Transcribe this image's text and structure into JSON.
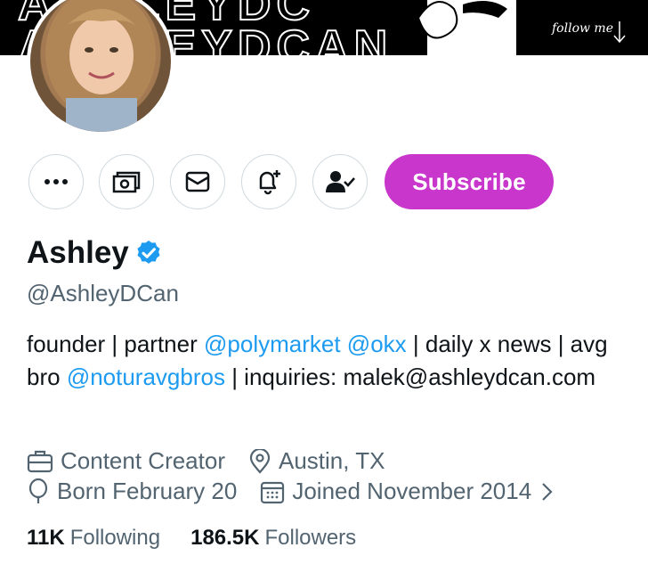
{
  "banner": {
    "follow_text": "follow me"
  },
  "profile": {
    "name": "Ashley",
    "handle": "@AshleyDCan",
    "verified_color": "#1d9bf0"
  },
  "actions": {
    "more_icon": "more-icon",
    "tip_icon": "money-icon",
    "message_icon": "mail-icon",
    "notify_icon": "bell-plus-icon",
    "following_icon": "person-check-icon",
    "subscribe_label": "Subscribe",
    "subscribe_color": "#c936cc"
  },
  "bio": {
    "part1": "founder | partner ",
    "mention1": "@polymarket",
    "space": " ",
    "mention2": "@okx",
    "part2": " | daily x news | avg bro ",
    "mention3": "@noturavgbros",
    "part3": " | inquiries: malek@ashleydcan.com"
  },
  "meta": {
    "category": "Content Creator",
    "location": "Austin, TX",
    "birthday": "Born February 20",
    "joined": "Joined November 2014"
  },
  "stats": {
    "following_count": "11K",
    "following_label": "Following",
    "followers_count": "186.5K",
    "followers_label": "Followers"
  }
}
